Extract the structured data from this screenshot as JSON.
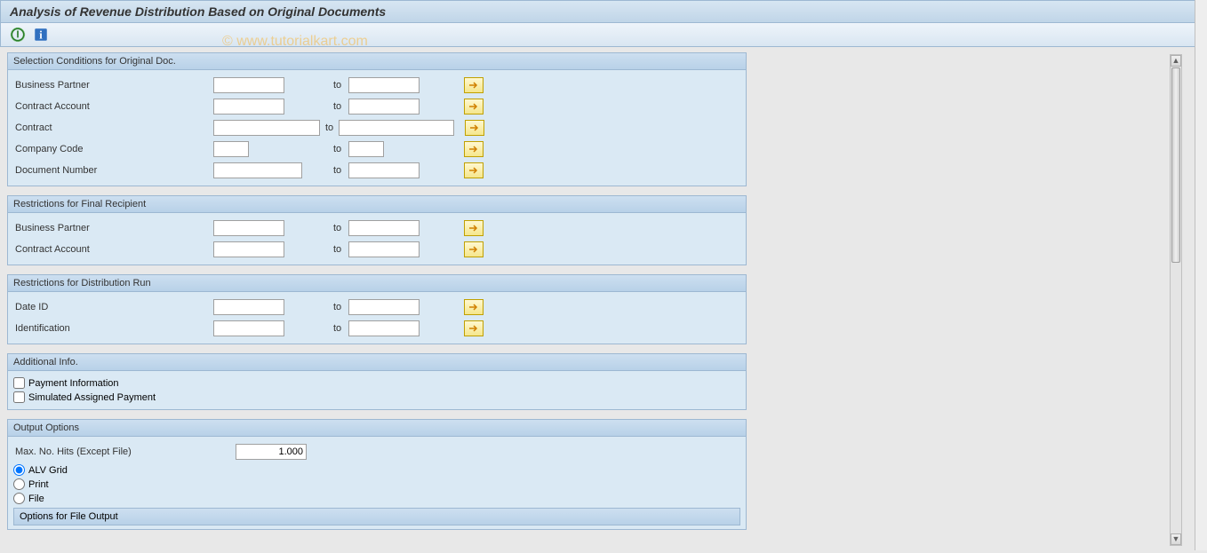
{
  "header": {
    "title": "Analysis of Revenue Distribution Based on Original Documents"
  },
  "watermark": "© www.tutorialkart.com",
  "toolbar": {
    "execute_icon": "execute",
    "info_icon": "info"
  },
  "groups": {
    "g1": {
      "title": "Selection Conditions for Original Doc.",
      "rows": [
        {
          "label": "Business Partner",
          "to": "to"
        },
        {
          "label": "Contract Account",
          "to": "to"
        },
        {
          "label": "Contract",
          "to": "to",
          "wide": true
        },
        {
          "label": "Company Code",
          "to": "to",
          "comp": true
        },
        {
          "label": "Document Number",
          "to": "to",
          "doc": true
        }
      ]
    },
    "g2": {
      "title": "Restrictions for Final Recipient",
      "rows": [
        {
          "label": "Business Partner",
          "to": "to"
        },
        {
          "label": "Contract Account",
          "to": "to"
        }
      ]
    },
    "g3": {
      "title": "Restrictions for Distribution Run",
      "rows": [
        {
          "label": "Date ID",
          "to": "to"
        },
        {
          "label": "Identification",
          "to": "to"
        }
      ]
    },
    "g4": {
      "title": "Additional Info.",
      "checks": [
        {
          "label": "Payment Information"
        },
        {
          "label": "Simulated Assigned Payment"
        }
      ]
    },
    "g5": {
      "title": "Output Options",
      "max_hits_label": "Max. No. Hits (Except File)",
      "max_hits_value": "1.000",
      "radios": [
        {
          "label": "ALV Grid",
          "checked": true
        },
        {
          "label": "Print"
        },
        {
          "label": "File"
        }
      ],
      "sub_header": "Options for File Output"
    }
  }
}
